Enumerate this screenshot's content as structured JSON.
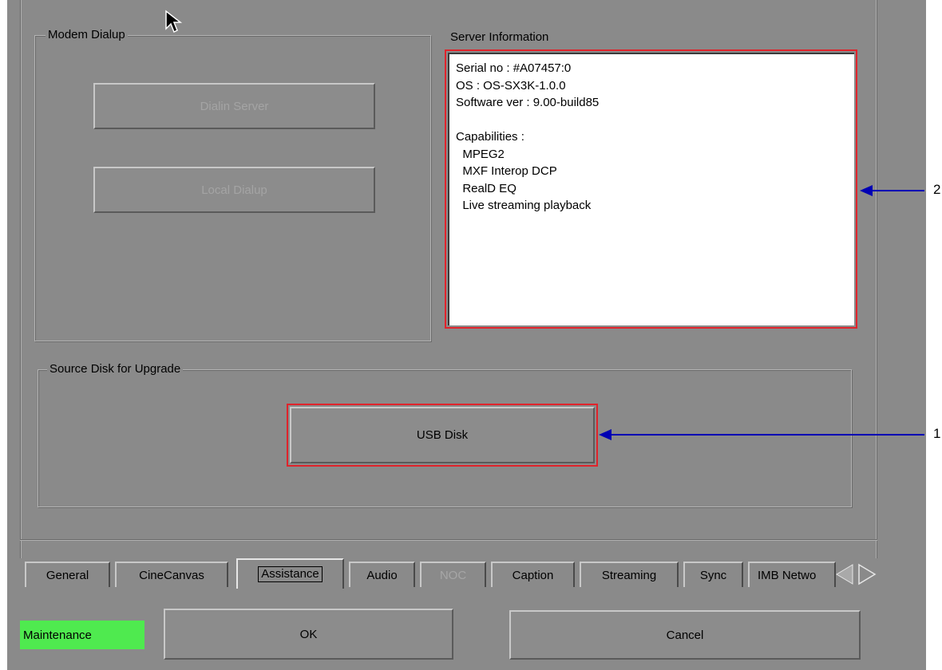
{
  "colors": {
    "background": "#8a8a8a",
    "highlight_box": "#e0232b",
    "callout_arrow": "#0000b4",
    "status_badge": "#4fea4f"
  },
  "modem_dialup": {
    "title": "Modem Dialup",
    "dialin_button": "Dialin Server",
    "local_button": "Local Dialup"
  },
  "server_info": {
    "title": "Server Information",
    "lines": [
      "Serial no : #A07457:0",
      "OS : OS-SX3K-1.0.0",
      "Software ver : 9.00-build85",
      "",
      "Capabilities :",
      "  MPEG2",
      "  MXF Interop DCP",
      "  RealD EQ",
      "  Live streaming playback"
    ]
  },
  "source_disk": {
    "title": "Source Disk for Upgrade",
    "usb_button": "USB Disk"
  },
  "tabs": [
    {
      "label": "General",
      "state": "normal"
    },
    {
      "label": "CineCanvas",
      "state": "normal"
    },
    {
      "label": "Assistance",
      "state": "active"
    },
    {
      "label": "Audio",
      "state": "normal"
    },
    {
      "label": "NOC",
      "state": "disabled"
    },
    {
      "label": "Caption",
      "state": "normal"
    },
    {
      "label": "Streaming",
      "state": "normal"
    },
    {
      "label": "Sync",
      "state": "normal"
    },
    {
      "label": "IMB Netwo",
      "state": "normal"
    }
  ],
  "tab_scroll": {
    "left_icon": "triangle-left-icon",
    "right_icon": "triangle-right-icon"
  },
  "footer": {
    "status": "Maintenance",
    "ok_button": "OK",
    "cancel_button": "Cancel"
  },
  "callouts": {
    "one": "1",
    "two": "2"
  },
  "cursor_icon": "mouse-pointer-icon"
}
